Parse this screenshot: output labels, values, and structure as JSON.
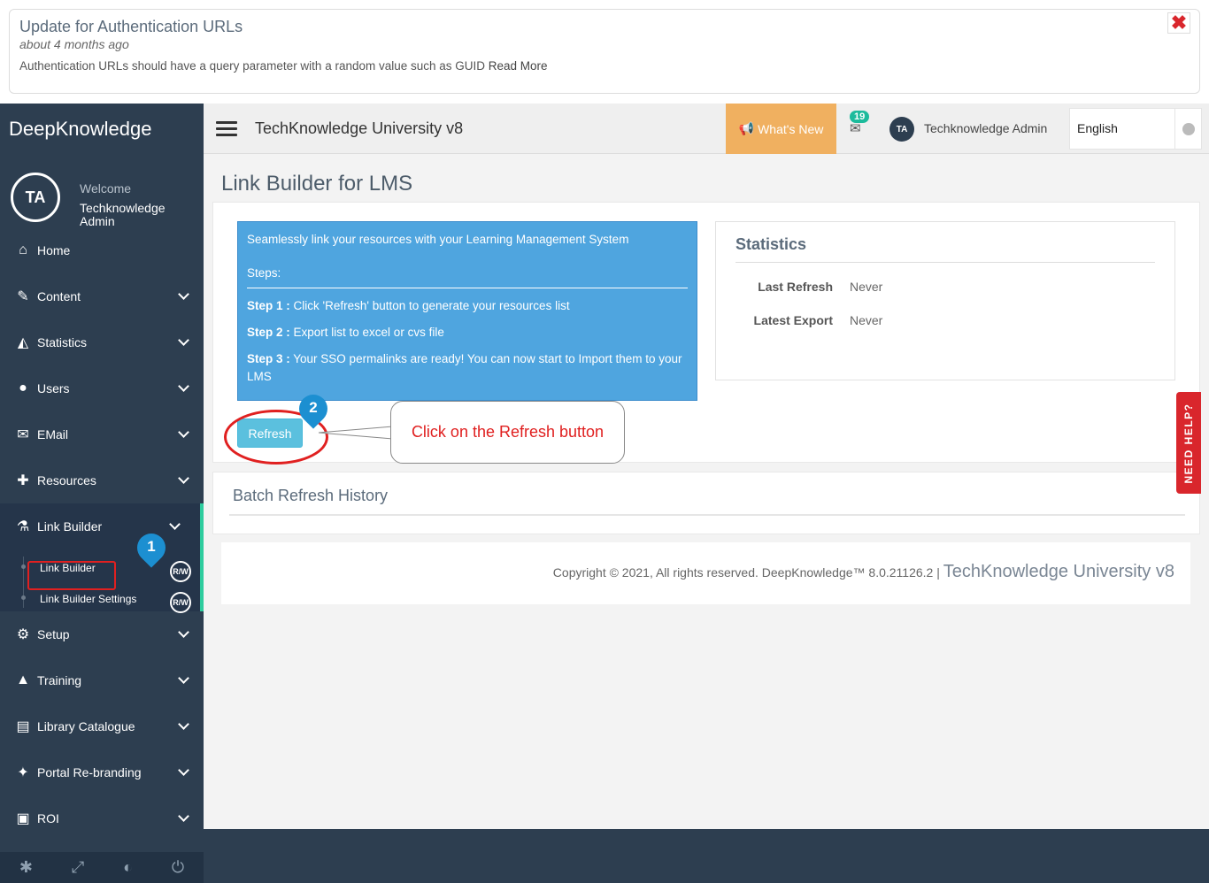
{
  "banner": {
    "title": "Update for Authentication URLs",
    "time": "about 4 months ago",
    "text": "Authentication URLs should have a query parameter with a random value such as GUID ",
    "read_more": "Read More"
  },
  "sidebar": {
    "brand": "DeepKnowledge",
    "avatar_initials": "TA",
    "welcome": "Welcome",
    "user_name": "Techknowledge Admin",
    "items": [
      {
        "label": "Home",
        "icon": "home-icon"
      },
      {
        "label": "Content",
        "icon": "edit-icon"
      },
      {
        "label": "Statistics",
        "icon": "area-chart-icon"
      },
      {
        "label": "Users",
        "icon": "users-icon"
      },
      {
        "label": "EMail",
        "icon": "envelope-icon"
      },
      {
        "label": "Resources",
        "icon": "puzzle-icon"
      },
      {
        "label": "Link Builder",
        "icon": "flask-icon"
      },
      {
        "label": "Setup",
        "icon": "gears-icon"
      },
      {
        "label": "Training",
        "icon": "graduation-cap-icon"
      },
      {
        "label": "Library Catalogue",
        "icon": "book-icon"
      },
      {
        "label": "Portal Re-branding",
        "icon": "magic-wand-icon"
      },
      {
        "label": "ROI",
        "icon": "money-icon"
      }
    ],
    "submenu": [
      {
        "label": "Link Builder",
        "badge": "R/W"
      },
      {
        "label": "Link Builder Settings",
        "badge": "R/W"
      }
    ]
  },
  "topbar": {
    "site_title": "TechKnowledge University v8",
    "whats_new": "What's New",
    "mail_count": "19",
    "avatar_initials": "TA",
    "user_name": "Techknowledge Admin",
    "language": "English"
  },
  "main": {
    "page_title": "Link Builder for LMS",
    "info": {
      "intro": "Seamlessly link your resources with your Learning Management System",
      "steps_label": "Steps:",
      "steps": [
        {
          "label": "Step 1 :",
          "text": " Click 'Refresh' button to generate your resources list"
        },
        {
          "label": "Step 2 :",
          "text": " Export list to excel or cvs file"
        },
        {
          "label": "Step 3 :",
          "text": " Your SSO permalinks are ready! You can now start to Import them to your LMS"
        }
      ]
    },
    "stats": {
      "title": "Statistics",
      "rows": [
        {
          "label": "Last Refresh",
          "value": "Never"
        },
        {
          "label": "Latest Export",
          "value": "Never"
        }
      ]
    },
    "refresh_button": "Refresh",
    "callout_text": "Click on the Refresh button",
    "batch_title": "Batch Refresh History",
    "footer": {
      "copyright": "Copyright © 2021, All rights reserved. DeepKnowledge™ 8.0.21126.2 | ",
      "site": "TechKnowledge University v8"
    },
    "need_help": "NEED HELP?"
  },
  "markers": [
    "1",
    "2"
  ],
  "colors": {
    "sidebar_bg": "#2d3e50",
    "accent_green": "#2ecc9e",
    "whats_new_bg": "#f0b060",
    "info_blue": "#4fa5df",
    "refresh_btn": "#5bc0de",
    "highlight_red": "#e02020",
    "marker_blue": "#1c8fd1"
  }
}
